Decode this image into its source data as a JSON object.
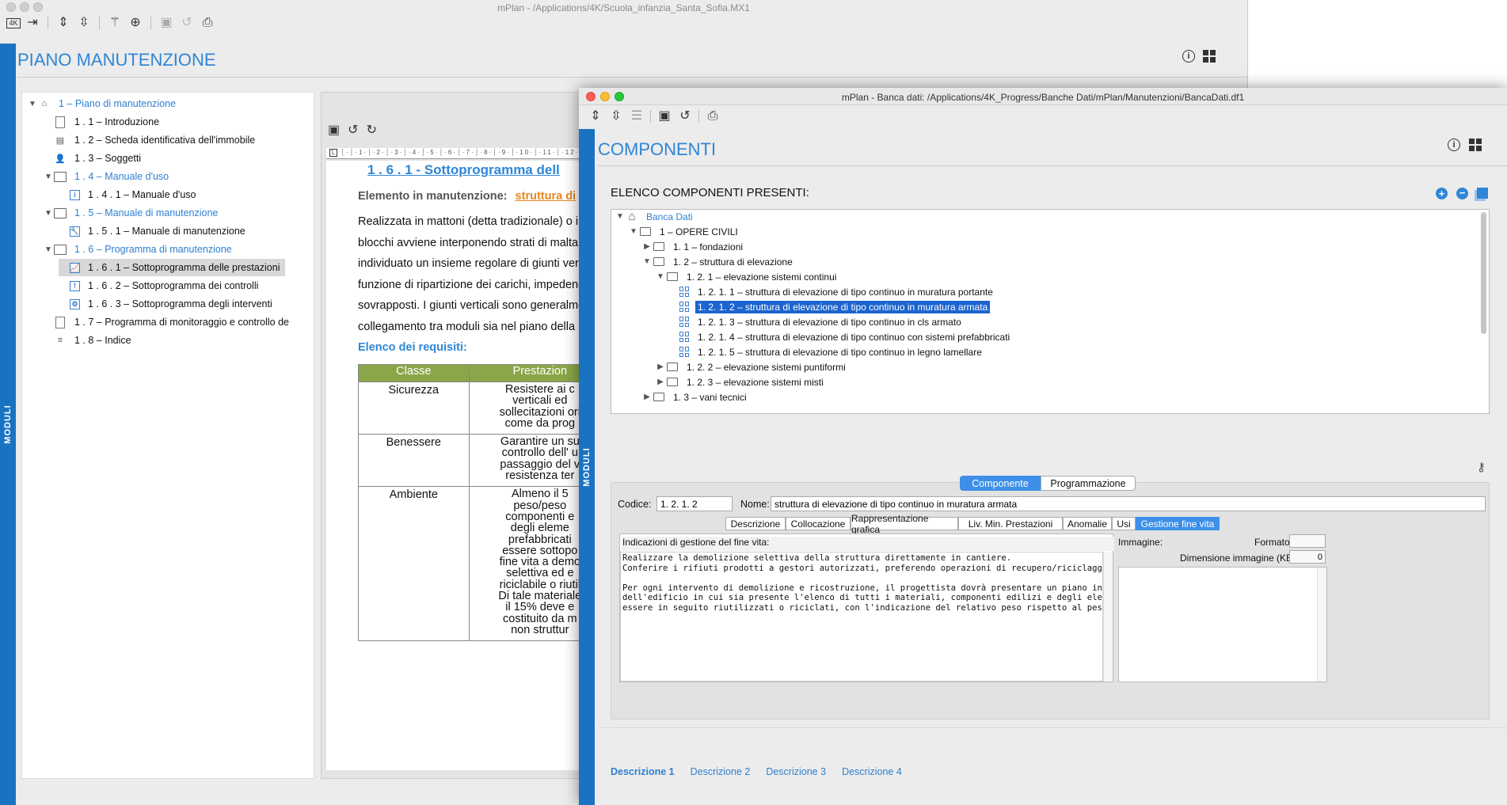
{
  "back_window": {
    "title": "mPlan - /Applications/4K/Scuola_infanzia_Santa_Sofia.MX1",
    "toolbar_icons": [
      "4k-icon",
      "exit-icon",
      "expand-icon",
      "collapse-icon",
      "magic-wand-icon",
      "add-circle-icon",
      "save-icon",
      "undo-icon",
      "print-icon"
    ],
    "modules_label": "MODULI",
    "section_title": "PIANO MANUTENZIONE",
    "tree": [
      {
        "label": "1 – Piano di manutenzione",
        "level": 0,
        "toggle": "▼",
        "icon": "home",
        "color": "blue"
      },
      {
        "label": "1 . 1 – Introduzione",
        "level": 1,
        "toggle": "",
        "icon": "doc",
        "color": "black"
      },
      {
        "label": "1 . 2 – Scheda identificativa dell'immobile",
        "level": 1,
        "toggle": "",
        "icon": "card",
        "color": "black"
      },
      {
        "label": "1 . 3 – Soggetti",
        "level": 1,
        "toggle": "",
        "icon": "person",
        "color": "black"
      },
      {
        "label": "1 . 4 – Manuale d'uso",
        "level": 1,
        "toggle": "▼",
        "icon": "folder",
        "color": "blue"
      },
      {
        "label": "1 . 4 . 1 – Manuale d'uso",
        "level": 2,
        "toggle": "",
        "icon": "info",
        "color": "black"
      },
      {
        "label": "1 . 5 – Manuale di manutenzione",
        "level": 1,
        "toggle": "▼",
        "icon": "folder",
        "color": "blue"
      },
      {
        "label": "1 . 5 . 1 – Manuale di manutenzione",
        "level": 2,
        "toggle": "",
        "icon": "wrench",
        "color": "black"
      },
      {
        "label": "1 . 6 – Programma di manutenzione",
        "level": 1,
        "toggle": "▼",
        "icon": "folder",
        "color": "blue"
      },
      {
        "label": "1 . 6 . 1 – Sottoprogramma delle prestazioni",
        "level": 2,
        "toggle": "",
        "icon": "chart",
        "color": "black",
        "selected": true
      },
      {
        "label": "1 . 6 . 2 – Sottoprogramma dei controlli",
        "level": 2,
        "toggle": "",
        "icon": "alert",
        "color": "black"
      },
      {
        "label": "1 . 6 . 3 – Sottoprogramma degli interventi",
        "level": 2,
        "toggle": "",
        "icon": "tool",
        "color": "black"
      },
      {
        "label": "1 . 7 – Programma di monitoraggio e controllo de",
        "level": 1,
        "toggle": "",
        "icon": "doc",
        "color": "black"
      },
      {
        "label": "1 . 8 – Indice",
        "level": 1,
        "toggle": "",
        "icon": "list",
        "color": "black"
      }
    ],
    "doc": {
      "heading": "1 . 6 . 1 - Sottoprogramma dell",
      "element_label": "Elemento in manutenzione:",
      "element_value": "struttura di",
      "paragraph_lines": [
        "Realizzata in mattoni (detta tradizionale) o i",
        "blocchi avviene interponendo strati di malta",
        "individuato un insieme regolare di giunti vert",
        "funzione di ripartizione dei carichi, impedenc",
        "sovrapposti. I giunti verticali sono generalme",
        "collegamento tra moduli sia nel piano della r"
      ],
      "requirements_title": "Elenco dei requisiti:",
      "table_headers": [
        "Classe",
        "Prestazion"
      ],
      "table_rows": [
        {
          "classe": "Sicurezza",
          "lines": [
            "Resistere ai c",
            "verticali ed",
            "sollecitazioni ori",
            "come da prog"
          ]
        },
        {
          "classe": "Benessere",
          "lines": [
            "Garantire un su",
            "controllo dell' u",
            "passaggio del v",
            "resistenza ter"
          ]
        },
        {
          "classe": "Ambiente",
          "lines": [
            "Almeno il 5",
            "peso/peso",
            "componenti e",
            "degli eleme",
            "prefabbricati",
            "essere sottopo",
            "fine vita a demo",
            "selettiva ed e",
            "riciclabile o riutil",
            "Di tale materiale",
            "il 15% deve e",
            "costituito da m",
            "non struttur"
          ]
        }
      ]
    }
  },
  "front_window": {
    "title": "mPlan - Banca dati: /Applications/4K_Progress/Banche Dati/mPlan/Manutenzioni/BancaDati.df1",
    "toolbar_icons": [
      "expand-icon",
      "collapse-icon",
      "list-icon",
      "save-icon",
      "undo-icon",
      "print-icon"
    ],
    "modules_label": "MODULI",
    "section_title": "COMPONENTI",
    "list_title": "ELENCO COMPONENTI PRESENTI:",
    "tree": [
      {
        "label": "Banca Dati",
        "level": 0,
        "toggle": "▼",
        "icon": "home",
        "color": "blue"
      },
      {
        "label": "1 – OPERE CIVILI",
        "level": 1,
        "toggle": "▼",
        "icon": "folder"
      },
      {
        "label": "1. 1 – fondazioni",
        "level": 2,
        "toggle": "▶",
        "icon": "folder"
      },
      {
        "label": "1. 2 – struttura di elevazione",
        "level": 2,
        "toggle": "▼",
        "icon": "folder"
      },
      {
        "label": "1. 2. 1 – elevazione sistemi continui",
        "level": 3,
        "toggle": "▼",
        "icon": "folder"
      },
      {
        "label": "1. 2. 1. 1 – struttura di elevazione di tipo continuo in muratura portante",
        "level": 4,
        "toggle": "",
        "icon": "grid"
      },
      {
        "label": "1. 2. 1. 2 – struttura di elevazione di tipo continuo in muratura armata",
        "level": 4,
        "toggle": "",
        "icon": "grid",
        "selected": true
      },
      {
        "label": "1. 2. 1. 3 – struttura di elevazione di tipo continuo in cls armato",
        "level": 4,
        "toggle": "",
        "icon": "grid"
      },
      {
        "label": "1. 2. 1. 4 – struttura di elevazione di tipo continuo con sistemi prefabbricati",
        "level": 4,
        "toggle": "",
        "icon": "grid"
      },
      {
        "label": "1. 2. 1. 5 – struttura di elevazione di tipo continuo in legno lamellare",
        "level": 4,
        "toggle": "",
        "icon": "grid"
      },
      {
        "label": "1. 2. 2 – elevazione sistemi puntiformi",
        "level": 3,
        "toggle": "▶",
        "icon": "folder"
      },
      {
        "label": "1. 2. 3 – elevazione sistemi misti",
        "level": 3,
        "toggle": "▶",
        "icon": "folder"
      },
      {
        "label": "1. 3 – vani tecnici",
        "level": 2,
        "toggle": "▶",
        "icon": "folder"
      }
    ],
    "top_tabs": [
      "Componente",
      "Programmazione"
    ],
    "codice_label": "Codice:",
    "codice_value": "1. 2. 1. 2",
    "nome_label": "Nome:",
    "nome_value": "struttura di elevazione di tipo continuo in muratura armata",
    "sub_tabs": [
      "Descrizione",
      "Collocazione",
      "Rappresentazione grafica",
      "Liv. Min. Prestazioni",
      "Anomalie",
      "Usi",
      "Gestione fine vita"
    ],
    "fine_vita_label": "Indicazioni di gestione del fine vita:",
    "fine_vita_lines": [
      "Realizzare la demolizione selettiva della struttura direttamente in cantiere.",
      "Conferire i rifiuti prodotti a gestori autorizzati, preferendo operazioni di recupero/riciclaggio.",
      "",
      "Per ogni intervento di demolizione e ricostruzione, il progettista dovrà presentare un piano inerente la fase di fine vita",
      "dell'edificio in cui sia presente l'elenco di tutti i materiali, componenti edilizi e degli elementi prefabbricati che possono",
      "essere in seguito riutilizzati o riciclati, con l'indicazione del relativo peso rispetto al peso totale dell'edificio."
    ],
    "immagine_label": "Immagine:",
    "formato_label": "Formato:",
    "formato_value": "",
    "dimensione_label": "Dimensione immagine (KB):",
    "dimensione_value": "0",
    "bottom_tabs": [
      "Descrizione 1",
      "Descrizione 2",
      "Descrizione 3",
      "Descrizione 4"
    ]
  },
  "colors": {
    "accent": "#2f86d6",
    "modules_bar": "#1a73c2",
    "selection": "#1c64cf",
    "table_header": "#8aa649",
    "orange": "#e8871e"
  }
}
